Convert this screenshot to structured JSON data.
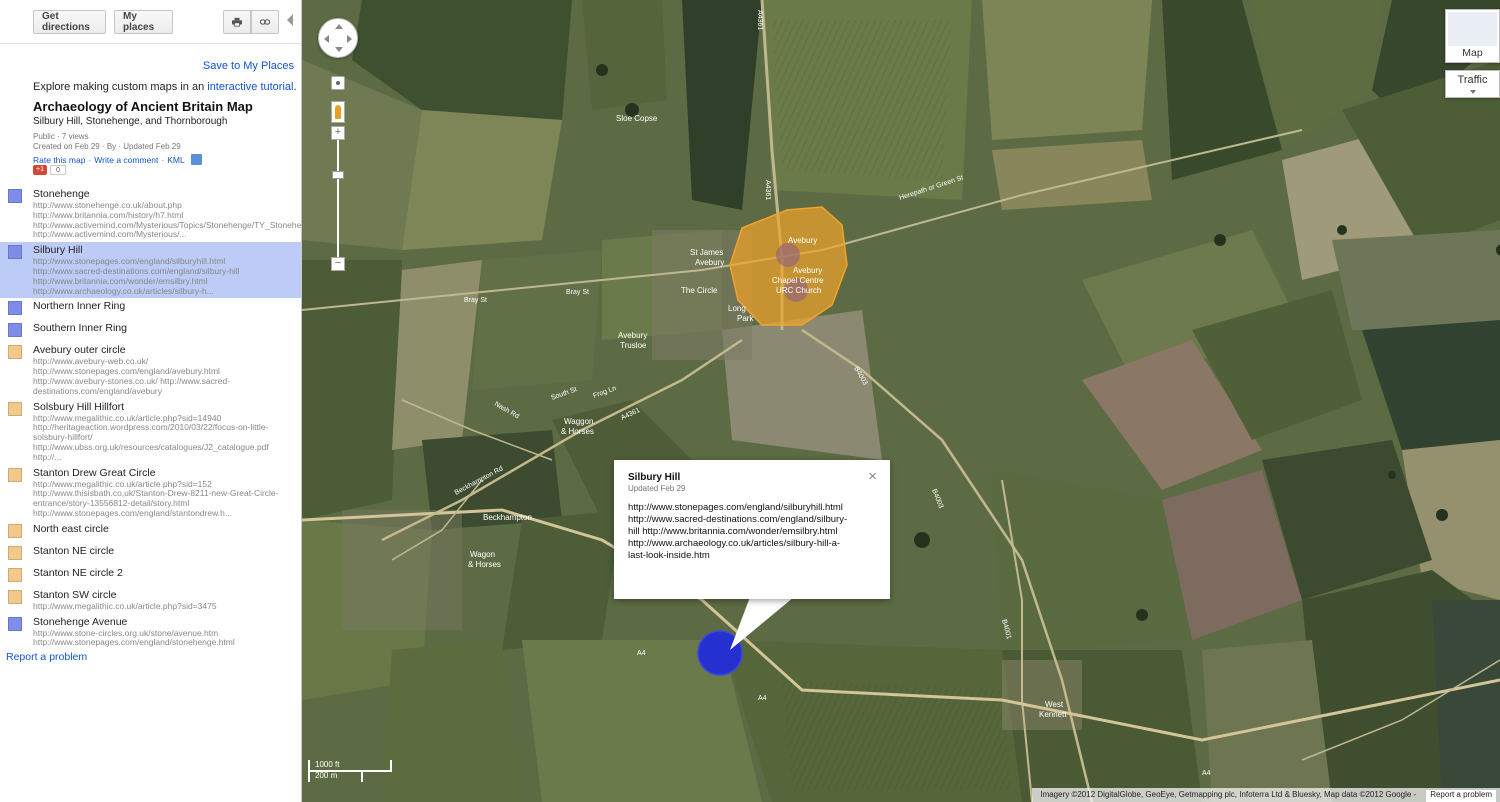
{
  "toolbar": {
    "directions_label": "Get directions",
    "myplaces_label": "My places",
    "print_icon": "printer-icon",
    "link_icon": "link-icon"
  },
  "sidebar": {
    "save_link": "Save to My Places",
    "explore_prefix": "Explore making custom maps in an ",
    "explore_link": "interactive tutorial",
    "explore_suffix": ".",
    "map_title": "Archaeology of Ancient Britain Map",
    "map_subtitle": "Silbury Hill, Stonehenge, and Thornborough",
    "meta_line1": "Public · 7 views",
    "meta_line2": "Created on Feb 29 · By  · Updated Feb 29",
    "actions": [
      "Rate this map",
      "Write a comment",
      "KML"
    ],
    "plusone_label": "+1",
    "plusone_count": "0",
    "report_problem": "Report a problem",
    "places": [
      {
        "name": "Stonehenge",
        "color": "#7f8ce8",
        "selected": false,
        "desc": "http://www.stonehenge.co.uk/about.php\nhttp://www.britannia.com/history/h7.html\nhttp://www.activemind.com/Mysterious/Topics/Stonehenge/TY_Stonehenge\nhttp://www.activemind.com/Mysterious/..."
      },
      {
        "name": "Silbury Hill",
        "color": "#7f8ce8",
        "selected": true,
        "desc": "http://www.stonepages.com/england/silburyhill.html\nhttp://www.sacred-destinations.com/england/silbury-hill\nhttp://www.britannia.com/wonder/emsilbry.html\nhttp://www.archaeology.co.uk/articles/silbury-h..."
      },
      {
        "name": "Northern Inner Ring",
        "color": "#7f8ce8",
        "selected": false,
        "desc": ""
      },
      {
        "name": "Southern Inner Ring",
        "color": "#7f8ce8",
        "selected": false,
        "desc": ""
      },
      {
        "name": "Avebury outer circle",
        "color": "#f3c98a",
        "selected": false,
        "desc": "http://www.avebury-web.co.uk/\nhttp://www.stonepages.com/england/avebury.html\nhttp://www.avebury-stones.co.uk/ http://www.sacred-\ndestinations.com/england/avebury"
      },
      {
        "name": "Solsbury Hill Hillfort",
        "color": "#f3c98a",
        "selected": false,
        "desc": "http://www.megalithic.co.uk/article.php?sid=14940\nhttp://heritageaction.wordpress.com/2010/03/22/focus-on-little-\nsolsbury-hillfort/\nhttp://www.ubss.org.uk/resources/catalogues/J2_catalogue.pdf\nhttp://..."
      },
      {
        "name": "Stanton Drew Great Circle",
        "color": "#f3c98a",
        "selected": false,
        "desc": "http://www.megalithic.co.uk/article.php?sid=152\nhttp://www.thisisbath.co.uk/Stanton-Drew-8211-new-Great-Circle-\nentrance/story-13556812-detail/story.html\nhttp://www.stonepages.com/england/stantondrew.h..."
      },
      {
        "name": "North east circle",
        "color": "#f3c98a",
        "selected": false,
        "desc": ""
      },
      {
        "name": "Stanton NE circle",
        "color": "#f3c98a",
        "selected": false,
        "desc": ""
      },
      {
        "name": "Stanton NE circle 2",
        "color": "#f3c98a",
        "selected": false,
        "desc": ""
      },
      {
        "name": "Stanton SW circle",
        "color": "#f3c98a",
        "selected": false,
        "desc": "http://www.megalithic.co.uk/article.php?sid=3475"
      },
      {
        "name": "Stonehenge Avenue",
        "color": "#7f8ce8",
        "selected": false,
        "desc": "http://www.stone-circles.org.uk/stone/avenue.htm\nhttp://www.stonepages.com/england/stonehenge.html"
      }
    ]
  },
  "map": {
    "type_label": "Map",
    "traffic_label": "Traffic",
    "labels": {
      "sloe_copse": "Sloe Copse",
      "st_james": "St James",
      "avebury_small": "Avebury",
      "the_circle": "The Circle",
      "avebury": "Avebury",
      "avebury2": "Avebury",
      "chapel_centre": "Chapel Centre",
      "urc_church": "URC Church",
      "longleat": "Long",
      "park": "Park",
      "avebury_trusloe1": "Avebury",
      "avebury_trusloe2": "Trusloe",
      "waggon1": "Waggon",
      "waggon2": "& Horses",
      "beckhampton": "Beckhampton",
      "wagon1": "Wagon",
      "wagon2": "& Horses",
      "west_kennett1": "West",
      "west_kennett2": "Kennett",
      "bray_st": "Bray St",
      "bray_st2": "Bray St",
      "nash_rd": "Nash Rd",
      "beckhampton_rd": "Beckhampton Rd",
      "a4361": "A4361",
      "a4361b": "A4361",
      "a4361c": "A4361",
      "b4003": "B4003",
      "b4003b": "B4003",
      "a4": "A4",
      "a4b": "A4",
      "a4c": "A4",
      "b4001": "B4001",
      "herepath": "Herepath or Green St",
      "south_st": "South St",
      "frog_ln": "Frog Ln"
    },
    "infowindow": {
      "title": "Silbury Hill",
      "updated": "Updated Feb 29",
      "body": "http://www.stonepages.com/england/silburyhill.html\nhttp://www.sacred-destinations.com/england/silbury-\nhill http://www.britannia.com/wonder/emsilbry.html\nhttp://www.archaeology.co.uk/articles/silbury-hill-a-\nlast-look-inside.htm",
      "close_glyph": "×"
    },
    "scale_ft": "1000 ft",
    "scale_m": "200 m",
    "copyright": "Imagery ©2012 DigitalGlobe, GeoEye, Getmapping plc, Infoterra Ltd & Bluesky, Map data ©2012 Google -",
    "report_problem": "Report a problem",
    "overlay_colors": {
      "avebury": "#f2a42a",
      "silbury": "#2530d0"
    }
  }
}
